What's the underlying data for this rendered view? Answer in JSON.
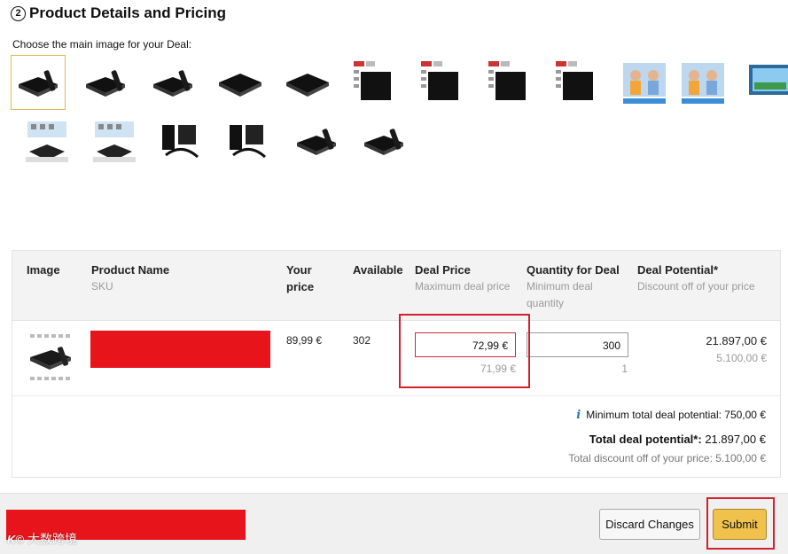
{
  "section": {
    "number": "2",
    "title": "Product Details and Pricing",
    "choose_label": "Choose the main image for your Deal:"
  },
  "thumbnails": [
    {
      "icon": "tv-box-remote-icon",
      "selected": true
    },
    {
      "icon": "tv-box-remote-icon",
      "selected": false
    },
    {
      "icon": "tv-box-remote-icon",
      "selected": false
    },
    {
      "icon": "tv-box-icon",
      "selected": false
    },
    {
      "icon": "tv-box-icon",
      "selected": false
    },
    {
      "icon": "tv-box-infographic-icon",
      "selected": false
    },
    {
      "icon": "tv-box-infographic-icon",
      "selected": false
    },
    {
      "icon": "tv-box-infographic-icon",
      "selected": false
    },
    {
      "icon": "tv-box-infographic-icon",
      "selected": false
    },
    {
      "icon": "people-photo-icon",
      "selected": false
    },
    {
      "icon": "people-photo-icon",
      "selected": false
    },
    {
      "icon": "tv-screen-photo-icon",
      "selected": false
    },
    {
      "icon": "setup-photo-icon",
      "selected": false
    },
    {
      "icon": "setup-photo-icon",
      "selected": false
    },
    {
      "icon": "accessories-icon",
      "selected": false
    },
    {
      "icon": "accessories-icon",
      "selected": false
    },
    {
      "icon": "tv-box-remote-icon",
      "selected": false
    },
    {
      "icon": "tv-box-remote-icon",
      "selected": false
    }
  ],
  "table": {
    "headers": {
      "image": "Image",
      "product_name": "Product Name",
      "product_name_sub": "SKU",
      "your_price": "Your price",
      "available": "Available",
      "deal_price": "Deal Price",
      "deal_price_sub": "Maximum deal price",
      "quantity": "Quantity for Deal",
      "quantity_sub": "Minimum deal quantity",
      "deal_potential": "Deal Potential*",
      "deal_potential_sub": "Discount off of your price"
    },
    "row": {
      "your_price": "89,99 €",
      "available": "302",
      "deal_price_value": "72,99 €",
      "max_deal_price": "71,99 €",
      "quantity_value": "300",
      "min_quantity": "1",
      "deal_potential": "21.897,00 €",
      "discount": "5.100,00 €"
    }
  },
  "summary": {
    "min_potential": "Minimum total deal potential: 750,00 €",
    "total_potential_label": "Total deal potential*:",
    "total_potential_value": "21.897,00 €",
    "total_discount": "Total discount off of your price: 5.100,00 €"
  },
  "footer": {
    "discard_label": "Discard Changes",
    "submit_label": "Submit"
  },
  "watermark": {
    "logo": "K©",
    "text": "大数跨境"
  },
  "colors": {
    "accent_highlight": "#d3212b",
    "submit_button": "#f0c14b",
    "redaction": "#e8141b",
    "info": "#2a7ab8"
  }
}
